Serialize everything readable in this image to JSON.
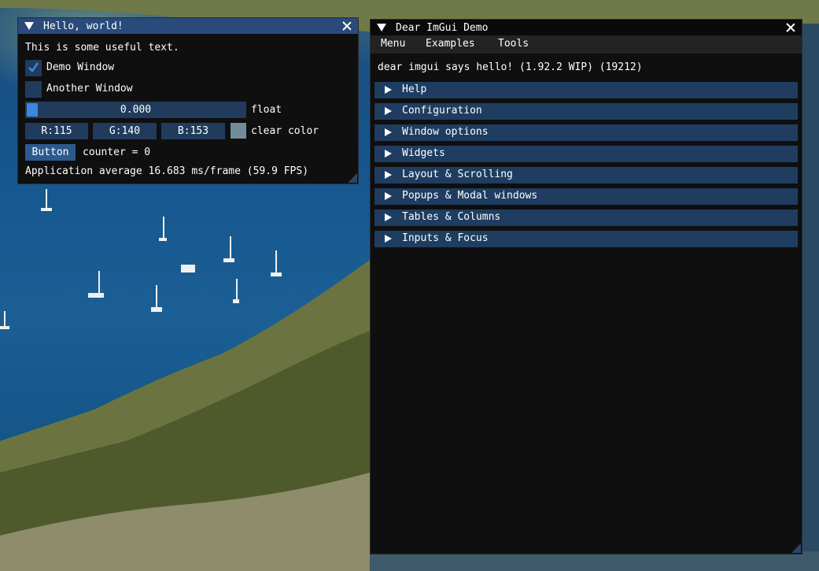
{
  "hello_window": {
    "title": "Hello, world!",
    "text": "This is some useful text.",
    "demo_window_checkbox": {
      "label": "Demo Window",
      "checked": true
    },
    "another_window_checkbox": {
      "label": "Another Window",
      "checked": false
    },
    "float_slider": {
      "value": "0.000",
      "label": "float"
    },
    "clear_color": {
      "r": "R:115",
      "g": "G:140",
      "b": "B:153",
      "label": "clear color",
      "swatch": "#738c99"
    },
    "button_label": "Button",
    "counter_text": "counter = 0",
    "fps_text": "Application average 16.683 ms/frame (59.9 FPS)"
  },
  "demo_window": {
    "title": "Dear ImGui Demo",
    "menu": [
      "Menu",
      "Examples",
      "Tools"
    ],
    "hello_text": "dear imgui says hello! (1.92.2 WIP) (19212)",
    "headers": [
      "Help",
      "Configuration",
      "Window options",
      "Widgets",
      "Layout & Scrolling",
      "Popups & Modal windows",
      "Tables & Columns",
      "Inputs & Focus"
    ]
  },
  "colors": {
    "title_active": "#294a7a",
    "frame_bg": "#213b5c",
    "header_bg": "#1e3d61",
    "window_bg": "#0f0f0f",
    "accent": "#3d85e0"
  }
}
